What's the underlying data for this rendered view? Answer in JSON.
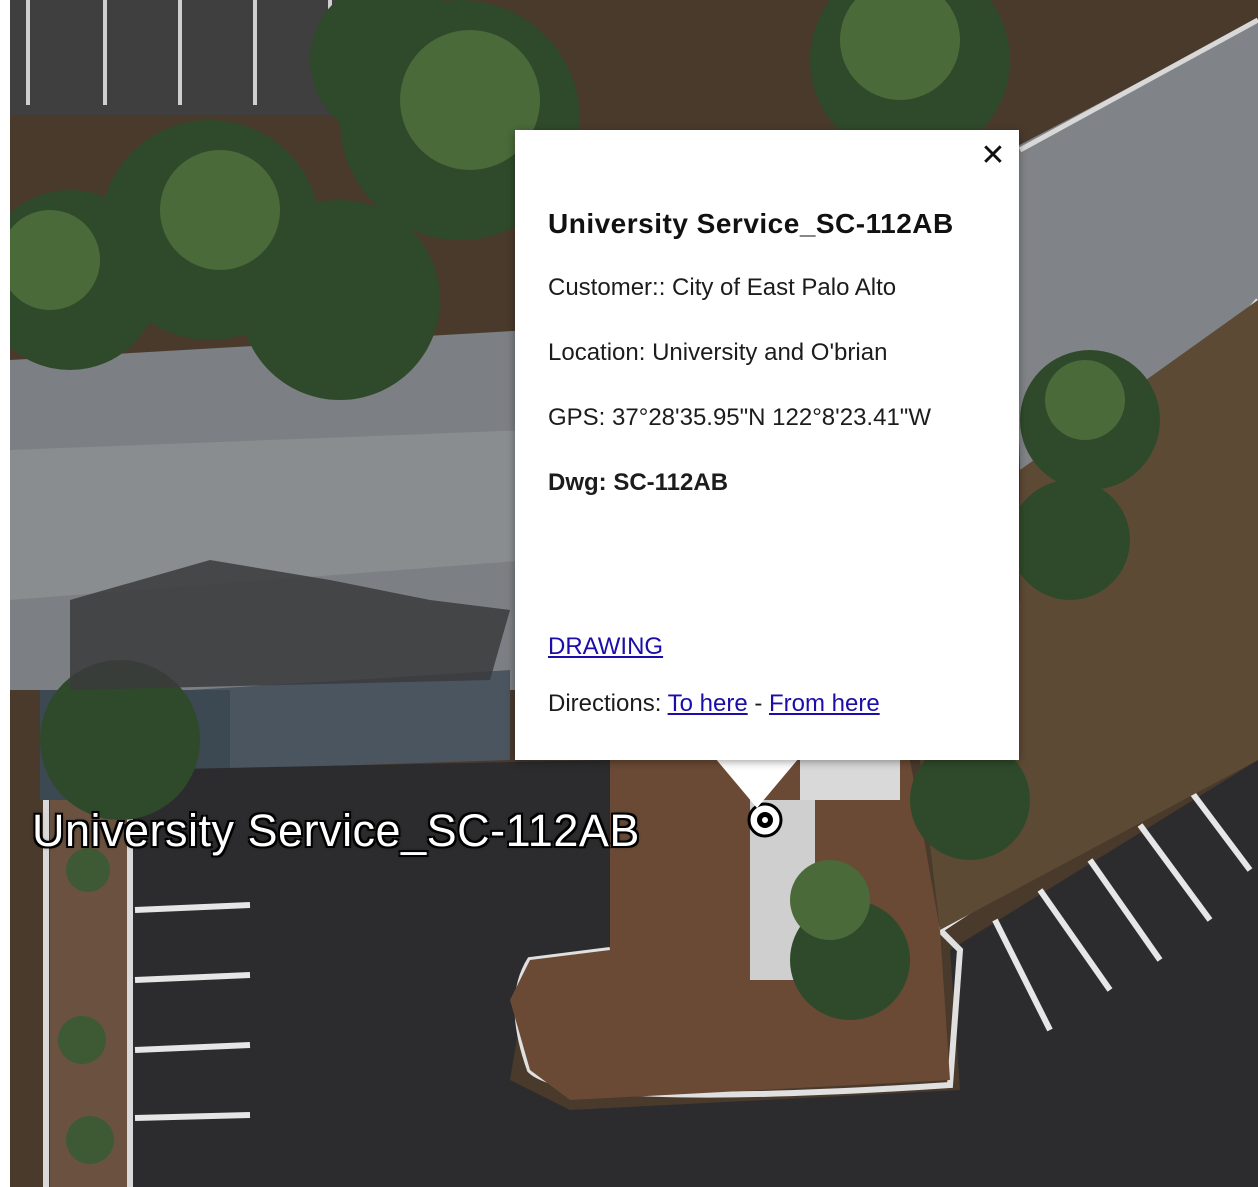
{
  "popup": {
    "close_icon": "close-icon",
    "title": "University Service_SC-112AB",
    "customer": "Customer:: City of East Palo Alto",
    "location": "Location: University and O'brian",
    "gps": "GPS: 37°28'35.95\"N 122°8'23.41\"W",
    "dwg": "Dwg: SC-112AB",
    "drawing_link": "DRAWING",
    "directions_label": "Directions: ",
    "to_here": "To here",
    "separator": " - ",
    "from_here": "From here"
  },
  "map": {
    "placemark_label": "University Service_SC-112AB",
    "placemark_icon": "target-icon"
  }
}
